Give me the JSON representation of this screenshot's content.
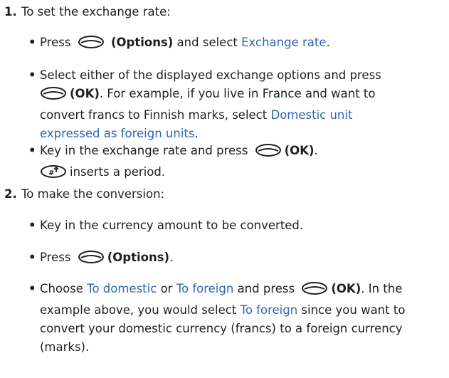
{
  "steps": [
    {
      "number": "1.",
      "text": "To set the exchange rate:",
      "bullets": [
        {
          "press": "Press",
          "options": "(Options)",
          "and_select": "and select",
          "menu": "Exchange rate",
          "end": "."
        },
        {
          "line1": "Select either of the displayed exchange options and press",
          "ok": "(OK)",
          "line2_rest": ". For example, if you live in France and want to",
          "line3": "convert francs to Finnish marks, select",
          "menu_part1": "Domestic unit",
          "menu_part2": "expressed as foreign units",
          "end": "."
        },
        {
          "line1": "Key in the exchange rate and press",
          "ok": "(OK)",
          "end": ".",
          "line2": "inserts a period."
        }
      ]
    },
    {
      "number": "2.",
      "text": "To make the conversion:",
      "bullets": [
        {
          "text": "Key in the currency amount to be converted."
        },
        {
          "press": "Press",
          "options": "(Options)",
          "end": "."
        },
        {
          "choose": "Choose",
          "menu_domestic": "To domestic",
          "or": "or",
          "menu_foreign": "To foreign",
          "and_press": "and press",
          "ok": "(OK)",
          "line1_rest": ". In the",
          "line2_a": "example above, you would select",
          "menu_foreign_2": "To foreign",
          "line2_b": "since you want to",
          "line3": "convert your domestic currency (francs) to a foreign currency",
          "line4": "(marks)."
        }
      ]
    }
  ],
  "bullet_glyph": "•",
  "icons": {
    "selection_key": "selection-key-icon",
    "hash_key": "hash-key-icon"
  }
}
